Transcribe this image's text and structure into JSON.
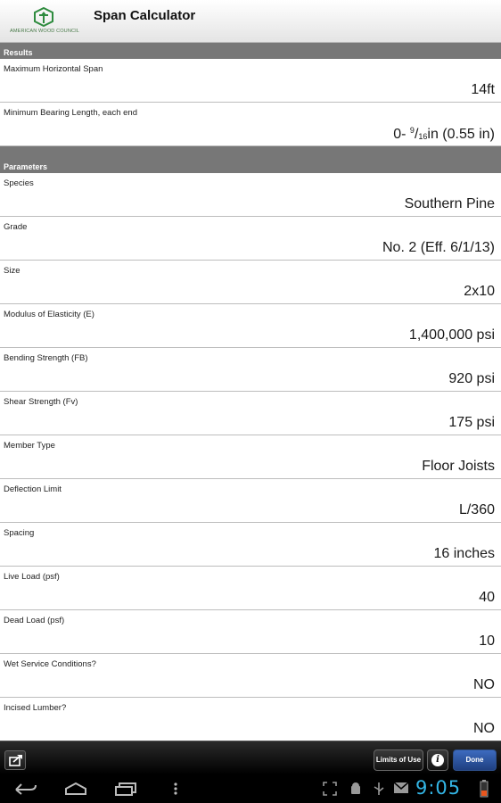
{
  "header": {
    "logo_text": "AMERICAN WOOD COUNCIL",
    "title": "Span Calculator"
  },
  "results": {
    "section_label": "Results",
    "rows": [
      {
        "label": "Maximum Horizontal Span",
        "value": "14ft"
      },
      {
        "label": "Minimum Bearing Length, each end",
        "value_prefix": "0- ",
        "frac_num": "9",
        "frac_den": "16",
        "value_suffix": "in (0.55 in)"
      }
    ]
  },
  "parameters": {
    "section_label": "Parameters",
    "rows": [
      {
        "label": "Species",
        "value": "Southern Pine"
      },
      {
        "label": "Grade",
        "value": "No. 2 (Eff. 6/1/13)"
      },
      {
        "label": "Size",
        "value": "2x10"
      },
      {
        "label": "Modulus of Elasticity (E)",
        "value": "1,400,000 psi"
      },
      {
        "label": "Bending Strength (FB)",
        "value": "920 psi"
      },
      {
        "label": "Shear Strength (Fv)",
        "value": "175 psi"
      },
      {
        "label": "Member Type",
        "value": "Floor Joists"
      },
      {
        "label": "Deflection Limit",
        "value": "L/360"
      },
      {
        "label": "Spacing",
        "value": "16 inches"
      },
      {
        "label": "Live Load (psf)",
        "value": "40"
      },
      {
        "label": "Dead Load (psf)",
        "value": "10"
      },
      {
        "label": "Wet Service Conditions?",
        "value": "NO"
      },
      {
        "label": "Incised Lumber?",
        "value": "NO"
      }
    ]
  },
  "toolbar": {
    "limits_label": "Limits of Use",
    "info_label": "i",
    "done_label": "Done"
  },
  "status": {
    "clock": "9:05"
  },
  "colors": {
    "brand_green": "#2e8b3e",
    "section_gray": "#777777",
    "done_blue": "#2f5aa8",
    "clock_blue": "#33b5e5"
  }
}
